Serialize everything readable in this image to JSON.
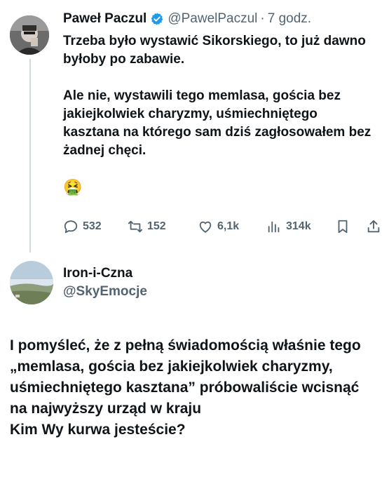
{
  "tweet": {
    "author_name": "Paweł Paczul",
    "author_handle": "@PawelPaczul",
    "separator": "·",
    "time": "7 godz.",
    "text_line1": "Trzeba było wystawić Sikorskiego, to już dawno byłoby po zabawie.",
    "text_line2": "Ale nie, wystawili tego memlasa, gościa bez jakiejkolwiek charyzmy, uśmiechniętego kasztana na którego sam dziś zagłosowałem bez żadnej chęci.",
    "emoji": "🤮",
    "stats": {
      "replies": "532",
      "retweets": "152",
      "likes": "6,1k",
      "views": "314k"
    },
    "icons": [
      "reply-icon",
      "retweet-icon",
      "like-icon",
      "views-icon",
      "bookmark-icon",
      "share-icon"
    ]
  },
  "reply": {
    "author_name": "Iron-i-Czna",
    "author_handle": "@SkyEmocje",
    "lines": [
      "I pomyśleć, że z pełną świadomością właśnie tego „memlasa, gościa bez jakiejkolwiek charyzmy, uśmiechniętego kasztana” próbowaliście wcisnąć na najwyższy urząd w kraju",
      "Kim Wy kurwa jesteście?"
    ]
  },
  "colors": {
    "text": "#0f1419",
    "secondary": "#536471",
    "verified": "#1d9bf0",
    "thread_line": "#cfd9de"
  }
}
